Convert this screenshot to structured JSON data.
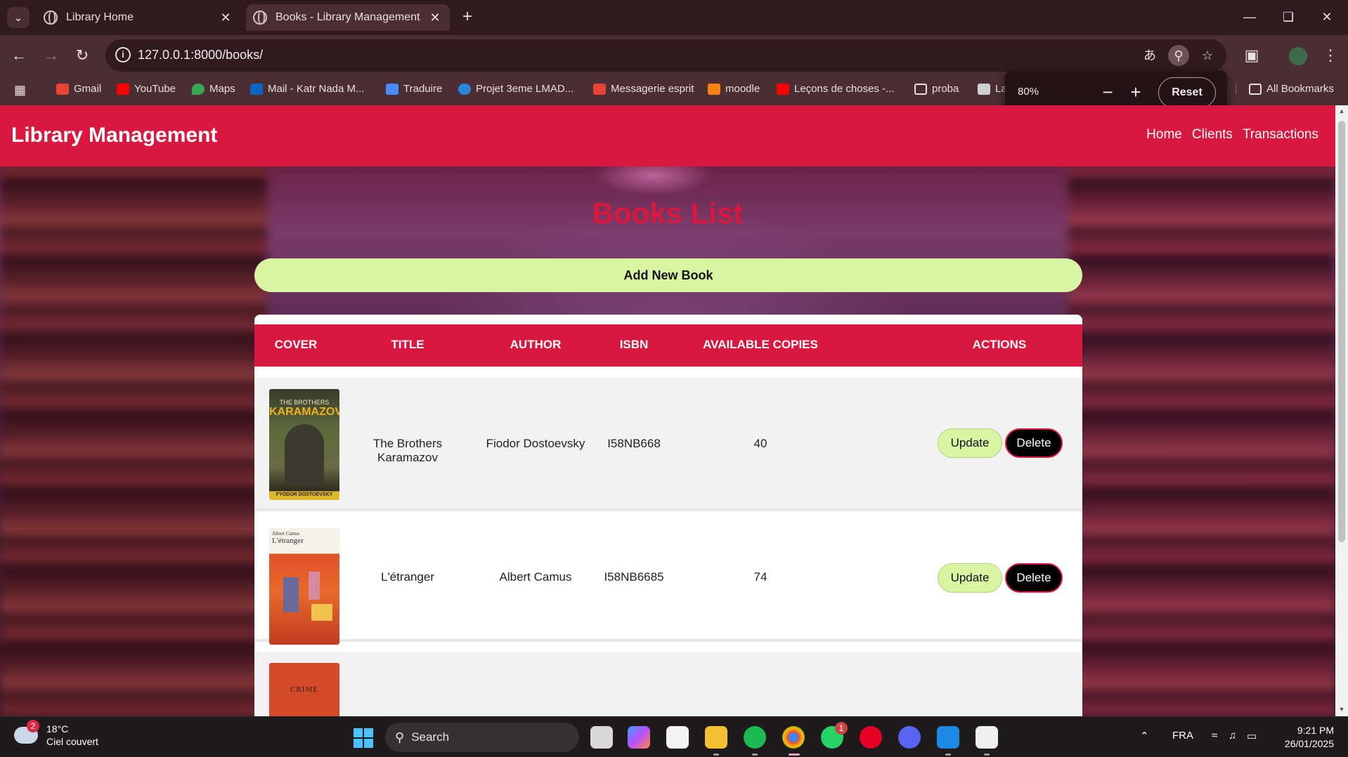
{
  "browser": {
    "tabs": [
      {
        "title": "Library Home",
        "active": false
      },
      {
        "title": "Books - Library Management",
        "active": true
      }
    ],
    "url": "127.0.0.1:8000/books/",
    "bookmarks": [
      {
        "label": "Gmail",
        "icon": "gmail-icon",
        "color": "#ea4335"
      },
      {
        "label": "YouTube",
        "icon": "youtube-icon",
        "color": "#ff0000"
      },
      {
        "label": "Maps",
        "icon": "maps-icon",
        "color": "#34a853"
      },
      {
        "label": "Mail - Katr Nada M...",
        "icon": "outlook-icon",
        "color": "#0a66c2"
      },
      {
        "label": "Traduire",
        "icon": "translate-icon",
        "color": "#4a8af4"
      },
      {
        "label": "Projet 3eme LMAD...",
        "icon": "onedrive-icon",
        "color": "#2b88d8"
      },
      {
        "label": "Messagerie esprit",
        "icon": "gmail-icon",
        "color": "#ea4335"
      },
      {
        "label": "moodle",
        "icon": "moodle-icon",
        "color": "#f98012"
      },
      {
        "label": "Leçons de choses -...",
        "icon": "youtube-icon",
        "color": "#ff0000"
      },
      {
        "label": "proba",
        "icon": "folder-icon",
        "color": "#e9dfe1"
      },
      {
        "label": "La",
        "icon": "app-icon",
        "color": "#cfcfcf"
      }
    ],
    "all_bookmarks": "All Bookmarks",
    "zoom": {
      "level": "80%",
      "reset_label": "Reset"
    }
  },
  "site": {
    "brand": "Library Management",
    "nav": [
      "Home",
      "Clients",
      "Transactions"
    ],
    "title": "Books List",
    "add_button": "Add New Book",
    "columns": [
      "COVER",
      "TITLE",
      "AUTHOR",
      "ISBN",
      "AVAILABLE COPIES",
      "ACTIONS"
    ],
    "books": [
      {
        "title": "The Brothers Karamazov",
        "author": "Fiodor Dostoevsky",
        "isbn": "I58NB668",
        "copies": "40",
        "cover": {
          "top": "THE BROTHERS",
          "main": "KARAMAZOV",
          "bottom": "FYODOR DOSTOEVSKY",
          "color": "#5a6a3a"
        }
      },
      {
        "title": "L'étranger",
        "author": "Albert Camus",
        "isbn": "I58NB6685",
        "copies": "74",
        "cover": {
          "top": "Albert Camus",
          "main": "L'étranger",
          "bottom": "",
          "color": "#e2512b"
        }
      },
      {
        "title": "",
        "author": "",
        "isbn": "",
        "copies": "",
        "cover": {
          "top": "",
          "main": "CRIME",
          "bottom": "",
          "color": "#d24a28"
        }
      }
    ],
    "update_label": "Update",
    "delete_label": "Delete"
  },
  "taskbar": {
    "weather_temp": "18°C",
    "weather_desc": "Ciel couvert",
    "weather_badge": "2",
    "search_label": "Search",
    "whatsapp_badge": "1",
    "language": "FRA",
    "time": "9:21 PM",
    "date": "26/01/2025"
  }
}
